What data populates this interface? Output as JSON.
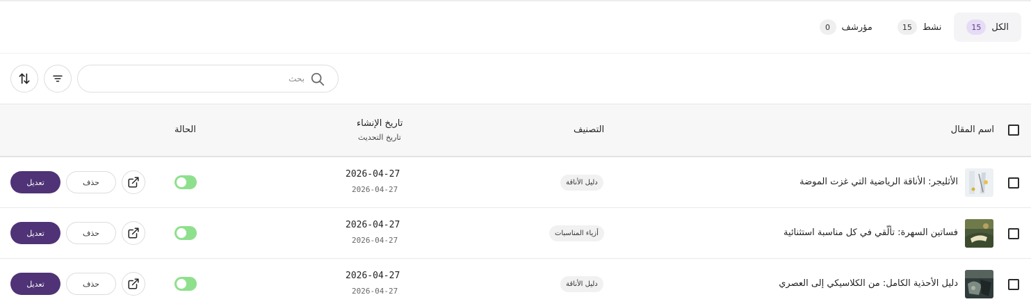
{
  "tabs": [
    {
      "label": "الكل",
      "count": "15",
      "active": true
    },
    {
      "label": "نشط",
      "count": "15",
      "active": false
    },
    {
      "label": "مؤرشف",
      "count": "0",
      "active": false
    }
  ],
  "search": {
    "placeholder": "بحث",
    "value": ""
  },
  "table": {
    "headers": {
      "name": "اسم المقال",
      "category": "التصنيف",
      "created": "تاريخ الإنشاء",
      "updated": "تاريخ التحديث",
      "status": "الحالة"
    },
    "rows": [
      {
        "title": "الأثليجر: الأناقة الرياضية التي غزت الموضة",
        "category": "دليل الأناقة",
        "created": "2026-04-27",
        "updated": "2026-04-27",
        "active": true,
        "delete_label": "حذف",
        "edit_label": "تعديل"
      },
      {
        "title": "فساتين السهرة: تألّقي في كل مناسبة استثنائية",
        "category": "أزياء المناسبات",
        "created": "2026-04-27",
        "updated": "2026-04-27",
        "active": true,
        "delete_label": "حذف",
        "edit_label": "تعديل"
      },
      {
        "title": "دليل الأحذية الكامل: من الكلاسيكي إلى العصري",
        "category": "دليل الأناقة",
        "created": "2026-04-27",
        "updated": "2026-04-27",
        "active": true,
        "delete_label": "حذف",
        "edit_label": "تعديل"
      }
    ]
  },
  "icons": {
    "search": "search-icon",
    "filter": "filter-icon",
    "sort": "sort-icon",
    "external_link": "external-link-icon"
  },
  "colors": {
    "accent": "#4f3376",
    "toggle_on": "#8fe08d",
    "active_tab_badge": "#e6dcf6"
  }
}
